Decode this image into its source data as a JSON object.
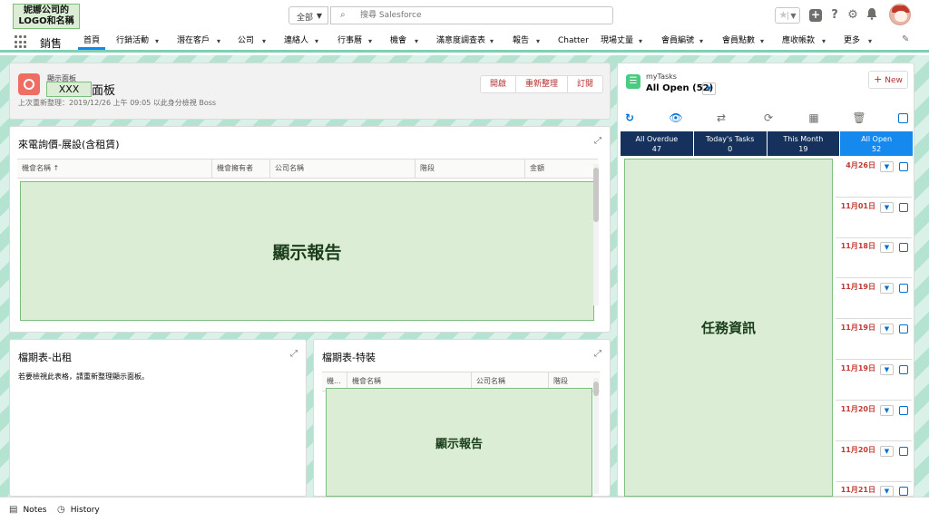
{
  "header": {
    "logo_text": "妮娜公司的\nLOGO和名稱",
    "search_scope": "全部",
    "search_placeholder": "搜尋 Salesforce",
    "avatar_label": "user avatar"
  },
  "nav": {
    "app_name": "銷售",
    "items": [
      {
        "label": "首頁",
        "active": true,
        "has_menu": false
      },
      {
        "label": "行銷活動",
        "has_menu": true
      },
      {
        "label": "潛在客戶",
        "has_menu": true
      },
      {
        "label": "公司",
        "has_menu": true
      },
      {
        "label": "連絡人",
        "has_menu": true
      },
      {
        "label": "行事曆",
        "has_menu": true
      },
      {
        "label": "機會",
        "has_menu": true
      },
      {
        "label": "滿意度調查表",
        "has_menu": true
      },
      {
        "label": "報告",
        "has_menu": true
      },
      {
        "label": "Chatter",
        "has_menu": false
      },
      {
        "label": "現場丈量",
        "has_menu": true
      },
      {
        "label": "會員編號",
        "has_menu": true
      },
      {
        "label": "會員點數",
        "has_menu": true
      },
      {
        "label": "應收帳款",
        "has_menu": true
      },
      {
        "label": "更多",
        "has_menu": true
      }
    ]
  },
  "dashboard": {
    "type_label": "顯示面板",
    "title_suffix": "面板",
    "owner_box": "XXX",
    "refresh_info": "上次重新整理：2019/12/26 上午 09:05 以此身分檢視 Boss",
    "buttons": {
      "open": "開啟",
      "refresh": "重新整理",
      "subscribe": "訂閱"
    }
  },
  "reports": {
    "inquiry": {
      "title": "來電詢價-展設(含租賃)",
      "columns": [
        "機會名稱 ↑",
        "機會擁有者",
        "公司名稱",
        "階段",
        "金額"
      ],
      "placeholder": "顯示報告"
    },
    "rent": {
      "title": "檔期表-出租",
      "message": "若要檢視此表格，請重新整理顯示面板。"
    },
    "special": {
      "title": "檔期表-特裝",
      "columns": [
        "機...",
        "機會名稱",
        "公司名稱",
        "階段"
      ],
      "placeholder": "顯示報告"
    }
  },
  "tasks": {
    "label": "myTasks",
    "filter": "All Open (52)",
    "new_label": "New",
    "tabs": [
      {
        "name": "All Overdue",
        "count": "47"
      },
      {
        "name": "Today's Tasks",
        "count": "0"
      },
      {
        "name": "This Month",
        "count": "19"
      },
      {
        "name": "All Open",
        "count": "52",
        "active": true
      }
    ],
    "placeholder": "任務資訊",
    "dates": [
      "4月26日",
      "11月01日",
      "11月18日",
      "11月19日",
      "11月19日",
      "11月19日",
      "11月20日",
      "11月20日",
      "11月21日"
    ]
  },
  "utility": {
    "notes": "Notes",
    "history": "History"
  },
  "colors": {
    "brand_blue": "#1589ee",
    "navy": "#16325c",
    "overdue_red": "#c23934",
    "placeholder_green": "#dbedd5",
    "background_teal": "#b5e3d2"
  }
}
